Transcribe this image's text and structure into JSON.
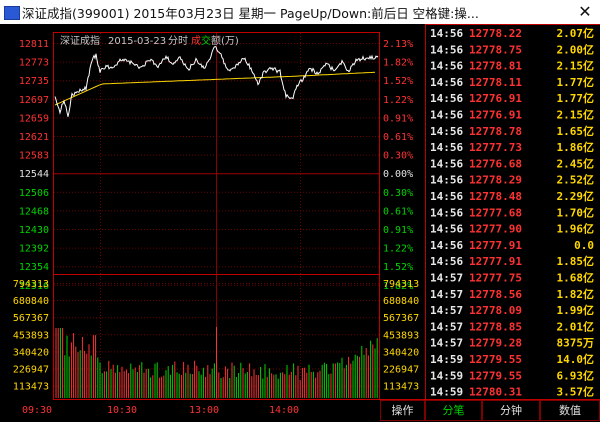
{
  "window": {
    "title": "深证成指(399001) 2015年03月23日 星期一 PageUp/Down:前后日 空格键:操...",
    "close_glyph": "✕"
  },
  "chart": {
    "index_name": "深证成指",
    "date": "2015-03-23",
    "period": "分时",
    "vol_label_cheng": "成",
    "vol_label_jiao": "交",
    "vol_label_rest": "额(万)",
    "price_axis": [
      "12811",
      "12773",
      "12735",
      "12697",
      "12659",
      "12621",
      "12583",
      "12544",
      "12506",
      "12468",
      "12430",
      "12392",
      "12354",
      "12316"
    ],
    "pct_axis": [
      "2.13%",
      "1.82%",
      "1.52%",
      "1.22%",
      "0.91%",
      "0.61%",
      "0.30%",
      "0.00%",
      "0.30%",
      "0.61%",
      "0.91%",
      "1.22%",
      "1.52%",
      "1.82%"
    ],
    "vol_axis": [
      "794313",
      "680840",
      "567367",
      "453893",
      "340420",
      "226947",
      "113473"
    ],
    "time_axis": [
      "09:30",
      "10:30",
      "13:00",
      "14:00"
    ],
    "colors": {
      "up": "#ff3232",
      "down": "#00d200",
      "price_line": "#ffffff",
      "avg_line": "#ffd700",
      "grid": "#800000"
    }
  },
  "ticks": [
    {
      "time": "14:56",
      "price": "12778.22",
      "vol": "2.07亿",
      "color": "red"
    },
    {
      "time": "14:56",
      "price": "12778.75",
      "vol": "2.00亿",
      "color": "red"
    },
    {
      "time": "14:56",
      "price": "12778.81",
      "vol": "2.15亿",
      "color": "red"
    },
    {
      "time": "14:56",
      "price": "12778.11",
      "vol": "1.77亿",
      "color": "red"
    },
    {
      "time": "14:56",
      "price": "12776.91",
      "vol": "1.77亿",
      "color": "red"
    },
    {
      "time": "14:56",
      "price": "12776.91",
      "vol": "2.15亿",
      "color": "red"
    },
    {
      "time": "14:56",
      "price": "12778.78",
      "vol": "1.65亿",
      "color": "red"
    },
    {
      "time": "14:56",
      "price": "12777.73",
      "vol": "1.86亿",
      "color": "red"
    },
    {
      "time": "14:56",
      "price": "12776.68",
      "vol": "2.45亿",
      "color": "red"
    },
    {
      "time": "14:56",
      "price": "12778.29",
      "vol": "2.52亿",
      "color": "red"
    },
    {
      "time": "14:56",
      "price": "12778.48",
      "vol": "2.29亿",
      "color": "red"
    },
    {
      "time": "14:56",
      "price": "12777.68",
      "vol": "1.70亿",
      "color": "red"
    },
    {
      "time": "14:56",
      "price": "12777.90",
      "vol": "1.96亿",
      "color": "red"
    },
    {
      "time": "14:56",
      "price": "12777.91",
      "vol": "0.0",
      "color": "red"
    },
    {
      "time": "14:56",
      "price": "12777.91",
      "vol": "1.85亿",
      "color": "red"
    },
    {
      "time": "14:57",
      "price": "12777.75",
      "vol": "1.68亿",
      "color": "red"
    },
    {
      "time": "14:57",
      "price": "12778.56",
      "vol": "1.82亿",
      "color": "red"
    },
    {
      "time": "14:57",
      "price": "12778.09",
      "vol": "1.99亿",
      "color": "red"
    },
    {
      "time": "14:57",
      "price": "12778.85",
      "vol": "2.01亿",
      "color": "red"
    },
    {
      "time": "14:57",
      "price": "12779.28",
      "vol": "8375万",
      "color": "red"
    },
    {
      "time": "14:59",
      "price": "12779.55",
      "vol": "14.0亿",
      "color": "red"
    },
    {
      "time": "14:59",
      "price": "12779.55",
      "vol": "6.93亿",
      "color": "red"
    },
    {
      "time": "14:59",
      "price": "12780.31",
      "vol": "3.57亿",
      "color": "red"
    }
  ],
  "bottom_tabs": [
    {
      "label": "操作",
      "active": false
    },
    {
      "label": "分笔",
      "active": true
    },
    {
      "label": "分钟",
      "active": false
    },
    {
      "label": "数值",
      "active": false
    }
  ]
}
